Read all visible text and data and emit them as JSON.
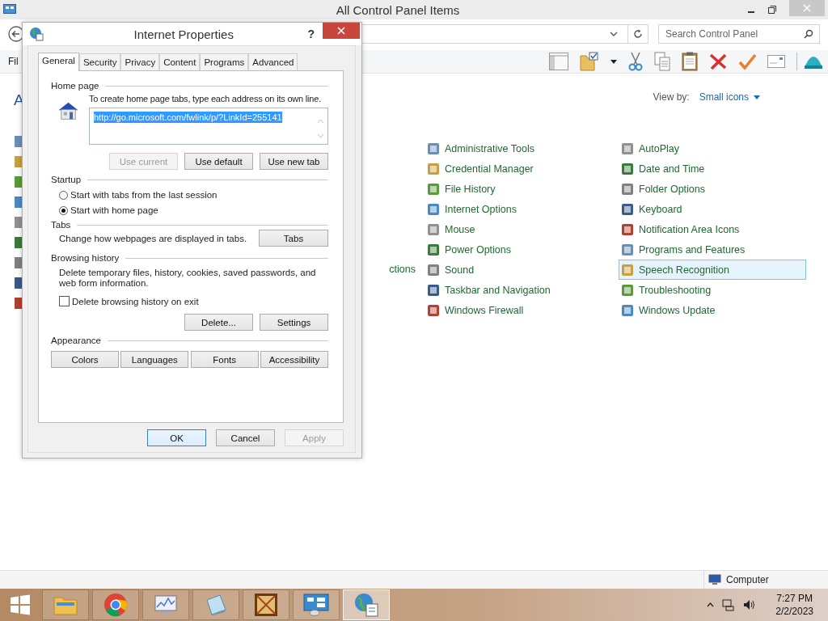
{
  "window": {
    "title": "All Control Panel Items"
  },
  "search": {
    "placeholder": "Search Control Panel"
  },
  "menu_fragment": "Fil",
  "heading_fragment": "A",
  "view_by": {
    "label": "View by:",
    "value": "Small icons"
  },
  "hidden_item_fragment": "ctions",
  "columns": [
    [
      {
        "label": "Administrative Tools",
        "selected": false
      },
      {
        "label": "Credential Manager",
        "selected": false
      },
      {
        "label": "File History",
        "selected": false
      },
      {
        "label": "Internet Options",
        "selected": false
      },
      {
        "label": "Mouse",
        "selected": false
      },
      {
        "label": "Power Options",
        "selected": false
      },
      {
        "label": "Sound",
        "selected": false
      },
      {
        "label": "Taskbar and Navigation",
        "selected": false
      },
      {
        "label": "Windows Firewall",
        "selected": false
      }
    ],
    [
      {
        "label": "AutoPlay",
        "selected": false
      },
      {
        "label": "Date and Time",
        "selected": false
      },
      {
        "label": "Folder Options",
        "selected": false
      },
      {
        "label": "Keyboard",
        "selected": false
      },
      {
        "label": "Notification Area Icons",
        "selected": false
      },
      {
        "label": "Programs and Features",
        "selected": false
      },
      {
        "label": "Speech Recognition",
        "selected": true
      },
      {
        "label": "Troubleshooting",
        "selected": false
      },
      {
        "label": "Windows Update",
        "selected": false
      }
    ]
  ],
  "status_bar": {
    "location": "Computer"
  },
  "taskbar": {
    "apps": [
      {
        "kind": "folder",
        "selected": false
      },
      {
        "kind": "browser",
        "selected": false
      },
      {
        "kind": "chart",
        "selected": false
      },
      {
        "kind": "notepad",
        "selected": false
      },
      {
        "kind": "box",
        "selected": false
      },
      {
        "kind": "panel",
        "selected": false
      },
      {
        "kind": "globe",
        "selected": true
      }
    ],
    "time": "7:27 PM",
    "date": "2/2/2023"
  },
  "dialog": {
    "title": "Internet Properties",
    "help": "?",
    "tabs": [
      {
        "label": "General",
        "selected": true
      },
      {
        "label": "Security",
        "selected": false
      },
      {
        "label": "Privacy",
        "selected": false
      },
      {
        "label": "Content",
        "selected": false
      },
      {
        "label": "Programs",
        "selected": false
      },
      {
        "label": "Advanced",
        "selected": false
      }
    ],
    "home_page": {
      "heading": "Home page",
      "hint": "To create home page tabs, type each address on its own line.",
      "value": "http://go.microsoft.com/fwlink/p/?LinkId=255141",
      "buttons": [
        {
          "label": "Use current",
          "disabled": true
        },
        {
          "label": "Use default",
          "disabled": false
        },
        {
          "label": "Use new tab",
          "disabled": false
        }
      ]
    },
    "startup": {
      "heading": "Startup",
      "options": [
        {
          "label": "Start with tabs from the last session",
          "selected": false
        },
        {
          "label": "Start with home page",
          "selected": true
        }
      ]
    },
    "tabs_group": {
      "heading": "Tabs",
      "text": "Change how webpages are displayed in tabs.",
      "button": "Tabs"
    },
    "history": {
      "heading": "Browsing history",
      "text": "Delete temporary files, history, cookies, saved passwords, and web form information.",
      "checkbox": {
        "label": "Delete browsing history on exit",
        "checked": false
      },
      "buttons": [
        {
          "label": "Delete...",
          "disabled": false
        },
        {
          "label": "Settings",
          "disabled": false
        }
      ]
    },
    "appearance": {
      "heading": "Appearance",
      "buttons": [
        "Colors",
        "Languages",
        "Fonts",
        "Accessibility"
      ]
    },
    "footer": [
      {
        "label": "OK",
        "disabled": false,
        "default": true
      },
      {
        "label": "Cancel",
        "disabled": false,
        "default": false
      },
      {
        "label": "Apply",
        "disabled": true,
        "default": false
      }
    ]
  }
}
